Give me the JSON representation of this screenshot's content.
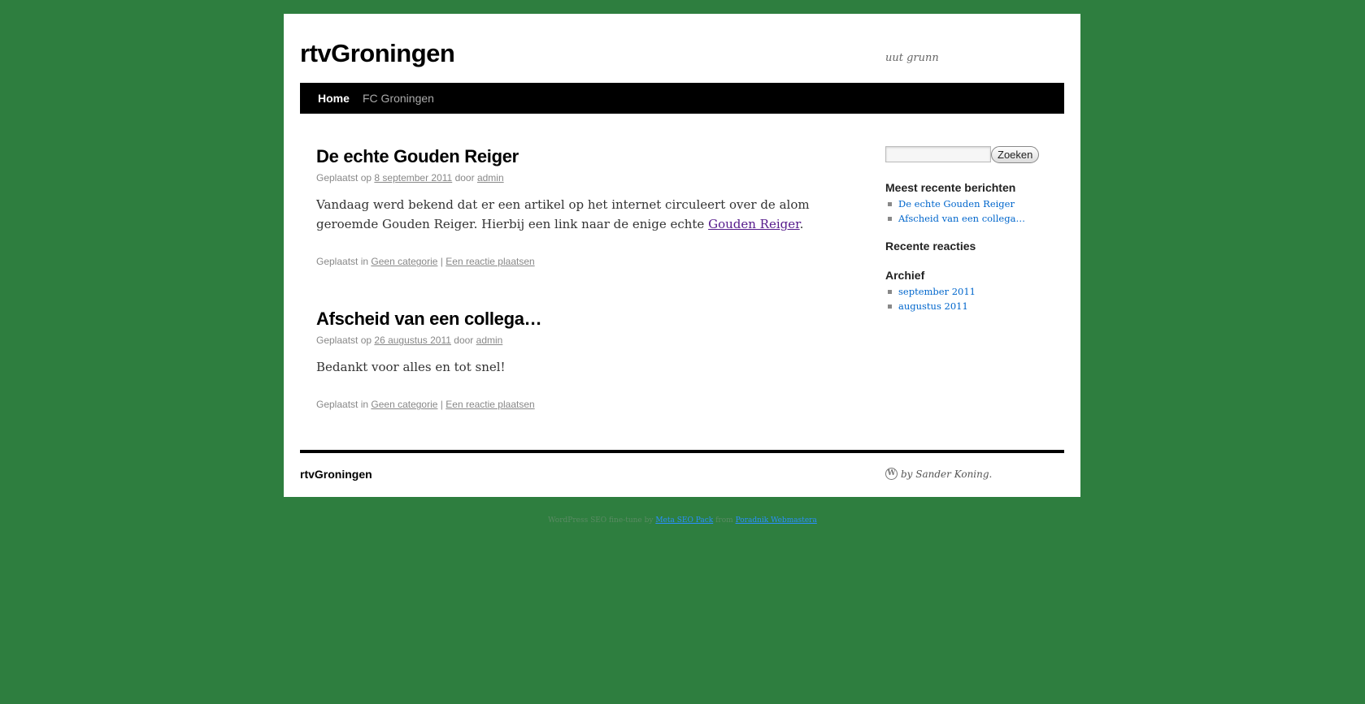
{
  "header": {
    "site_title": "rtvGroningen",
    "description": "uut grunn"
  },
  "nav": {
    "items": [
      {
        "label": "Home",
        "current": true
      },
      {
        "label": "FC Groningen",
        "current": false
      }
    ]
  },
  "posts": [
    {
      "title": "De echte Gouden Reiger",
      "meta_prefix": "Geplaatst op",
      "date": "8 september 2011",
      "by": "door",
      "author": "admin",
      "content_before": "Vandaag werd bekend dat er een artikel op het internet circuleert over de alom geroemde Gouden Reiger. Hierbij een link naar de enige echte ",
      "content_link": "Gouden Reiger",
      "content_after": ".",
      "utility_prefix": "Geplaatst in",
      "category": "Geen categorie",
      "separator": "|",
      "reply": "Een reactie plaatsen"
    },
    {
      "title": "Afscheid van een collega…",
      "meta_prefix": "Geplaatst op",
      "date": "26 augustus 2011",
      "by": "door",
      "author": "admin",
      "content_before": "Bedankt voor alles en tot snel!",
      "utility_prefix": "Geplaatst in",
      "category": "Geen categorie",
      "separator": "|",
      "reply": "Een reactie plaatsen"
    }
  ],
  "sidebar": {
    "search": {
      "value": "",
      "button_label": "Zoeken"
    },
    "recent_posts": {
      "title": "Meest recente berichten",
      "items": [
        "De echte Gouden Reiger",
        "Afscheid van een collega…"
      ]
    },
    "recent_comments": {
      "title": "Recente reacties"
    },
    "archive": {
      "title": "Archief",
      "items": [
        "september 2011",
        "augustus 2011"
      ]
    }
  },
  "footer": {
    "site_title": "rtvGroningen",
    "credit": "by Sander Koning.",
    "credit_icon": "wordpress-icon"
  },
  "credits": {
    "text_before": "WordPress SEO fine-tune by",
    "link1": "Meta SEO Pack",
    "text_middle": "from",
    "link2": "Poradnik Webmastera"
  },
  "colors": {
    "background": "#2e7e3f",
    "nav_bar": "#000000",
    "link_blue": "#0066cc",
    "visited_link": "#551a8b"
  }
}
